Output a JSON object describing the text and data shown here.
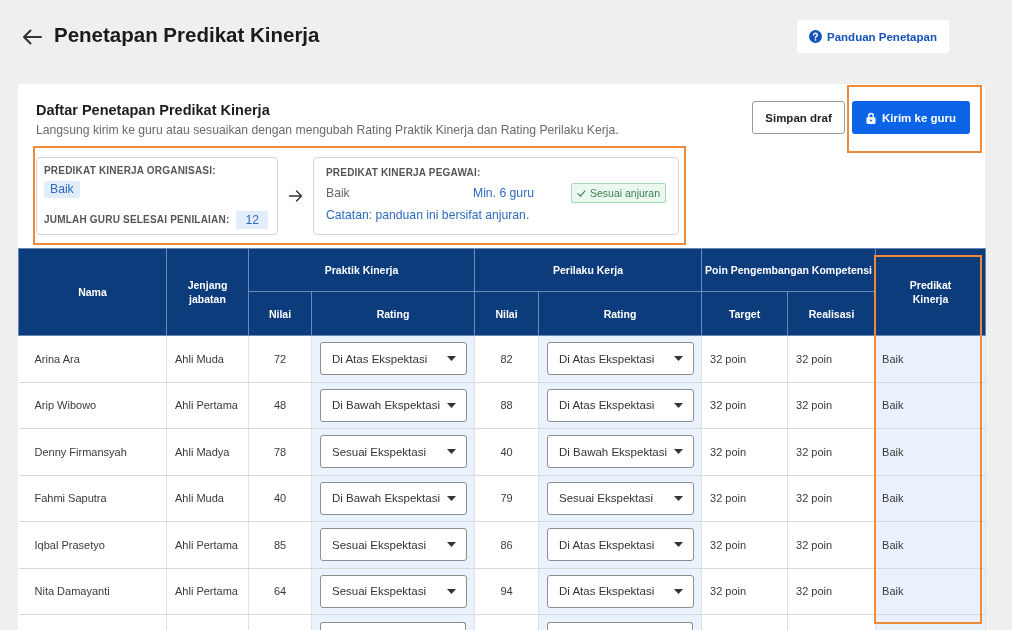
{
  "header": {
    "title": "Penetapan Predikat Kinerja",
    "help_button": "Panduan Penetapan"
  },
  "card": {
    "title": "Daftar Penetapan Predikat Kinerja",
    "subtitle": "Langsung kirim ke guru atau sesuaikan dengan mengubah Rating Praktik Kinerja dan Rating Perilaku Kerja.",
    "buttons": [
      {
        "label": "Simpan draf",
        "kind": "secondary",
        "highlighted": false
      },
      {
        "label": "Kirim ke guru",
        "kind": "primary",
        "highlighted": true
      }
    ]
  },
  "summary": {
    "highlighted": true,
    "organization": {
      "label": "PREDIKAT KINERJA ORGANISASI:",
      "value": "Baik"
    },
    "completed": {
      "label": "JUMLAH GURU SELESAI PENILAIAN:",
      "value": "12"
    },
    "employee": {
      "label": "PREDIKAT KINERJA PEGAWAI:",
      "predicate": "Baik",
      "quota": "Min. 6 guru",
      "status": "Sesuai anjuran",
      "note": "Catatan: panduan ini bersifat anjuran."
    }
  },
  "table": {
    "columns": [
      {
        "label": "Nama",
        "kind": "text",
        "highlighted": false
      },
      {
        "label": "Jenjang jabatan",
        "kind": "text",
        "highlighted": false
      },
      {
        "label": "Praktik Kinerja",
        "colspan": 2,
        "highlighted": false,
        "children": [
          {
            "label": "Nilai",
            "kind": "number"
          },
          {
            "label": "Rating",
            "kind": "select"
          }
        ]
      },
      {
        "label": "Perilaku Kerja",
        "colspan": 2,
        "highlighted": false,
        "children": [
          {
            "label": "Nilai",
            "kind": "number"
          },
          {
            "label": "Rating",
            "kind": "select"
          }
        ]
      },
      {
        "label": "Poin Pengembangan Kompetensi",
        "colspan": 2,
        "highlighted": false,
        "children": [
          {
            "label": "Target",
            "kind": "text"
          },
          {
            "label": "Realisasi",
            "kind": "text"
          }
        ]
      },
      {
        "label": "Predikat Kinerja",
        "kind": "result",
        "highlighted": true
      }
    ],
    "rows": [
      {
        "cells": [
          "Arina Ara",
          "Ahli Muda",
          "72",
          "Di Atas Ekspektasi",
          "82",
          "Di Atas Ekspektasi",
          "32 poin",
          "32 poin",
          "Baik"
        ]
      },
      {
        "cells": [
          "Arip Wibowo",
          "Ahli Pertama",
          "48",
          "Di Bawah Ekspektasi",
          "88",
          "Di Atas Ekspektasi",
          "32 poin",
          "32 poin",
          "Baik"
        ]
      },
      {
        "cells": [
          "Denny Firmansyah",
          "Ahli Madya",
          "78",
          "Sesuai Ekspektasi",
          "40",
          "Di Bawah Ekspektasi",
          "32 poin",
          "32 poin",
          "Baik"
        ]
      },
      {
        "cells": [
          "Fahmi Saputra",
          "Ahli Muda",
          "40",
          "Di Bawah Ekspektasi",
          "79",
          "Sesuai Ekspektasi",
          "32 poin",
          "32 poin",
          "Baik"
        ]
      },
      {
        "cells": [
          "Iqbal Prasetyo",
          "Ahli Pertama",
          "85",
          "Sesuai Ekspektasi",
          "86",
          "Di Atas Ekspektasi",
          "32 poin",
          "32 poin",
          "Baik"
        ]
      },
      {
        "cells": [
          "Nita Damayanti",
          "Ahli Pertama",
          "64",
          "Sesuai Ekspektasi",
          "94",
          "Di Atas Ekspektasi",
          "32 poin",
          "32 poin",
          "Baik"
        ]
      }
    ]
  }
}
